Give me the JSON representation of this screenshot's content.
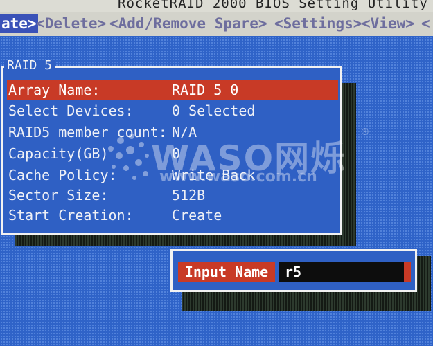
{
  "window": {
    "title": "RocketRAID 2000 BIOS Setting Utility"
  },
  "menu": {
    "items": [
      {
        "label": "ate>",
        "active": true
      },
      {
        "label": "<Delete>",
        "active": false
      },
      {
        "label": "<Add/Remove Spare>",
        "active": false
      },
      {
        "label": "<Settings>",
        "active": false
      },
      {
        "label": "<View>",
        "active": false
      },
      {
        "label": "<",
        "active": false
      }
    ]
  },
  "dialog": {
    "title": "RAID 5",
    "rows": [
      {
        "label": "Array Name:",
        "value": "RAID_5_0",
        "selected": true
      },
      {
        "label": "Select Devices:",
        "value": "0  Selected"
      },
      {
        "label": "RAID5 member count:",
        "value": "N/A"
      },
      {
        "label": "Capacity(GB)",
        "value": "0"
      },
      {
        "label": "Cache Policy:",
        "value": "Write Back"
      },
      {
        "label": "Sector Size:",
        "value": "512B"
      },
      {
        "label": "Start Creation:",
        "value": "Create"
      }
    ]
  },
  "popup": {
    "label": "Input Name",
    "value": "r5"
  },
  "watermark": {
    "logo": "WASO网烁",
    "registered": "®",
    "url": "www.waso.com.cn"
  },
  "colors": {
    "background": "#2f63c8",
    "highlight": "#c83a26",
    "menubar": "#d3d3cb",
    "menu_active": "#3a52b8"
  }
}
